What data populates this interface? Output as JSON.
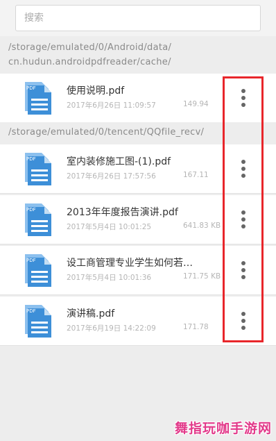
{
  "search": {
    "placeholder": "搜索"
  },
  "groups": [
    {
      "path_lines": [
        "/storage/emulated/0/Android/data/",
        "cn.hudun.androidpdfreader/cache/"
      ],
      "files": [
        {
          "name": "使用说明.pdf",
          "date": "2017年6月26日 11:09:57",
          "size": "149.94"
        }
      ]
    },
    {
      "path_lines": [
        "/storage/emulated/0/tencent/QQfile_recv/"
      ],
      "files": [
        {
          "name": "室内装修施工图-(1).pdf",
          "date": "2017年6月26日 17:57:56",
          "size": "167.11"
        },
        {
          "name": "2013年年度报告演讲.pdf",
          "date": "2017年5月4日 10:01:25",
          "size": "641.83 KB"
        },
        {
          "name": "设工商管理专业学生如何若…",
          "date": "2017年5月4日 10:01:36",
          "size": "171.75 KB"
        },
        {
          "name": "演讲稿.pdf",
          "date": "2017年6月19日 14:22:09",
          "size": "171.78"
        }
      ]
    }
  ],
  "icons": {
    "file": "pdf-file-icon",
    "more": "more-vertical-icon"
  },
  "icon_label": "PDF",
  "colors": {
    "icon_blue": "#3d8fd8",
    "icon_light": "#8cc0ee",
    "highlight": "#e8262b"
  },
  "watermark": "舞指玩咖手游网"
}
